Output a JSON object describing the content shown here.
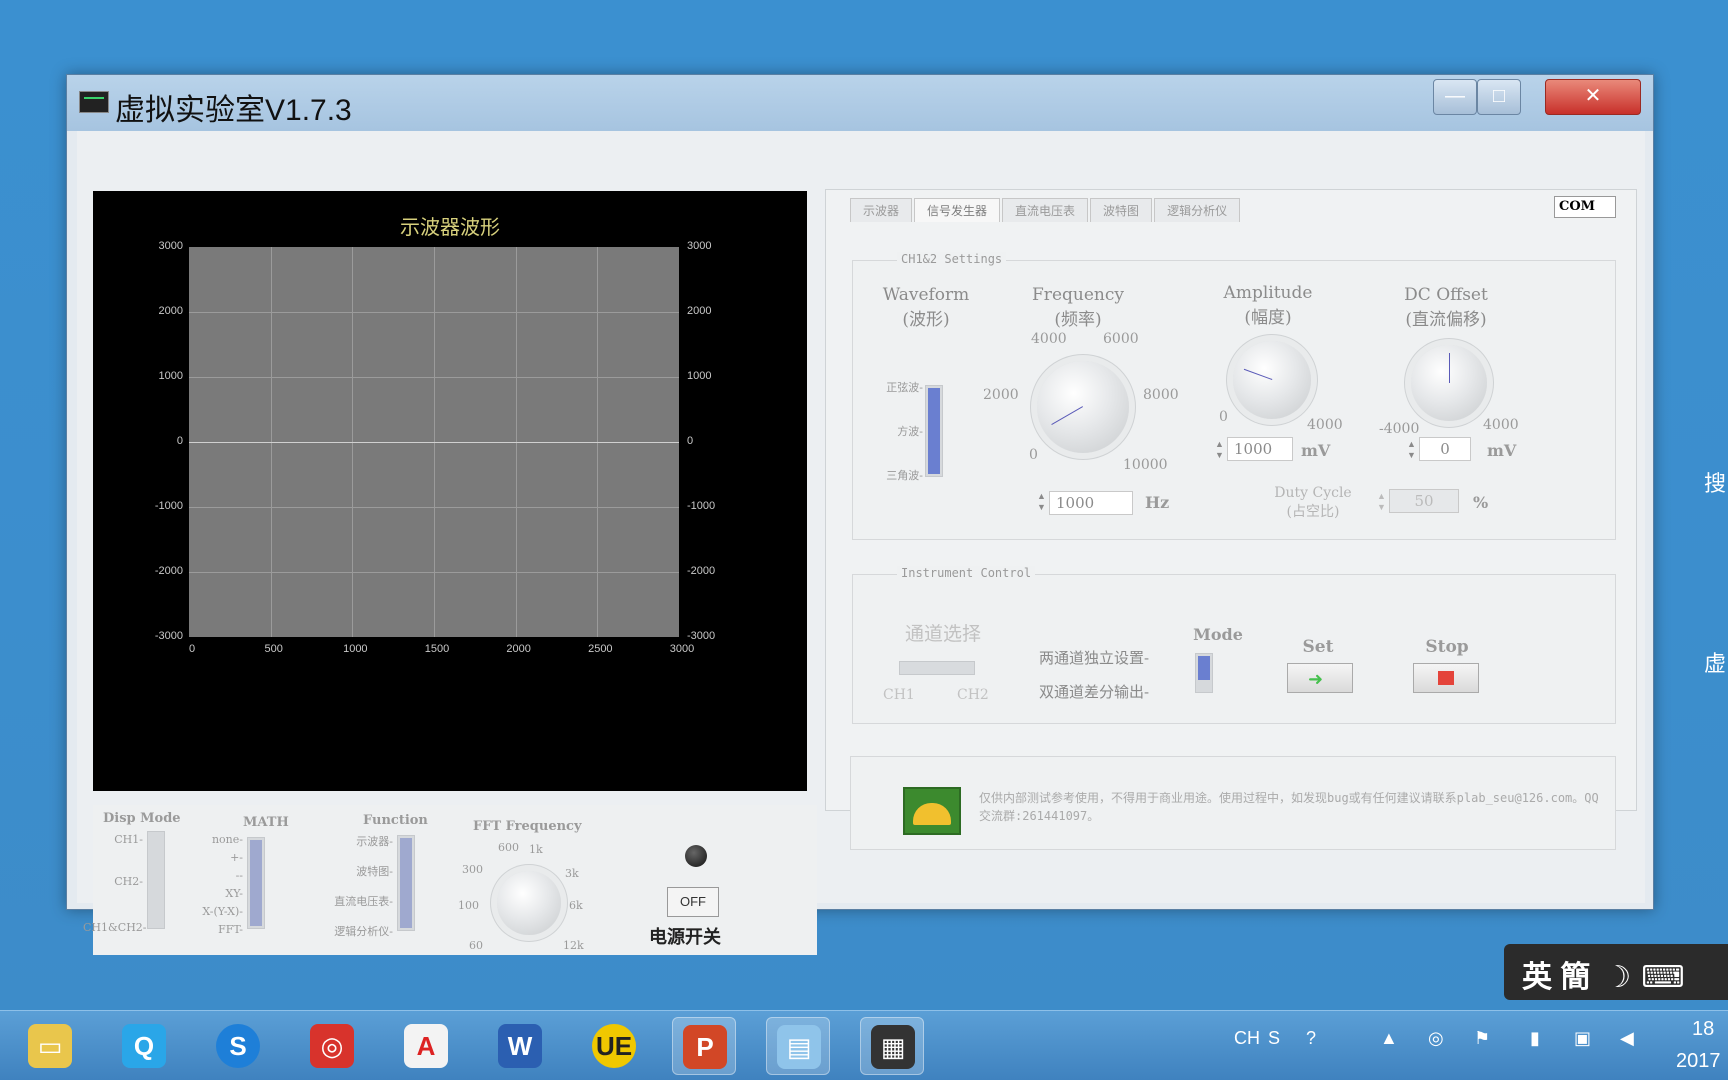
{
  "window": {
    "title": "虚拟实验室V1.7.3",
    "min_label": "—",
    "max_label": "□",
    "close_label": "✕"
  },
  "scope": {
    "title": "示波器波形",
    "yticks": [
      "3000",
      "2000",
      "1000",
      "0",
      "-1000",
      "-2000",
      "-3000"
    ],
    "xticks": [
      "0",
      "500",
      "1000",
      "1500",
      "2000",
      "2500",
      "3000"
    ]
  },
  "tabs": [
    "示波器",
    "信号发生器",
    "直流电压表",
    "波特图",
    "逻辑分析仪"
  ],
  "com": "COM",
  "settings": {
    "group_title": "CH1&2 Settings",
    "waveform": {
      "title": "Waveform",
      "subtitle": "(波形)",
      "options": [
        "正弦波-",
        "方波-",
        "三角波-"
      ],
      "selected_fraction": 1.0
    },
    "frequency": {
      "title": "Frequency",
      "subtitle": "(频率)",
      "scale": [
        "4000",
        "6000",
        "2000",
        "8000",
        "0",
        "10000"
      ],
      "value": "1000",
      "unit": "Hz"
    },
    "amplitude": {
      "title": "Amplitude",
      "subtitle": "(幅度)",
      "scale": [
        "0",
        "4000"
      ],
      "value": "1000",
      "unit": "mV"
    },
    "dc_offset": {
      "title": "DC Offset",
      "subtitle": "(直流偏移)",
      "scale": [
        "-4000",
        "4000"
      ],
      "value": "0",
      "unit": "mV"
    },
    "duty_cycle": {
      "title": "Duty Cycle",
      "subtitle": "(占空比)",
      "value": "50",
      "unit": "%"
    }
  },
  "control": {
    "group_title": "Instrument Control",
    "channel_title": "通道选择",
    "channel_left": "CH1",
    "channel_right": "CH2",
    "mode_title": "Mode",
    "mode_options": [
      "两通道独立设置-",
      "双通道差分输出-"
    ],
    "set_label": "Set",
    "stop_label": "Stop"
  },
  "info": {
    "text": "仅供内部测试参考使用，不得用于商业用途。使用过程中，如发现bug或有任何建议请联系plab_seu@126.com。QQ交流群:261441097。"
  },
  "bottom": {
    "disp_mode_title": "Disp Mode",
    "disp_mode_options": [
      "CH1-",
      "CH2-",
      "CH1&CH2-"
    ],
    "math_title": "MATH",
    "math_options": [
      "none-",
      "+-",
      "--",
      "XY-",
      "X-(Y-X)-",
      "FFT-"
    ],
    "function_title": "Function",
    "function_options": [
      "示波器-",
      "波特图-",
      "直流电压表-",
      "逻辑分析仪-"
    ],
    "fft_title": "FFT Frequency",
    "fft_scale": [
      "600",
      "1k",
      "300",
      "3k",
      "100",
      "6k",
      "60",
      "12k"
    ],
    "power_button": "OFF",
    "power_label": "电源开关"
  },
  "taskbar": {
    "tray": [
      "CH"
    ],
    "clock_hour": "18",
    "clock_year": "2017",
    "ime": "英 簡"
  },
  "desktop_edge": [
    "搜",
    "虚"
  ]
}
